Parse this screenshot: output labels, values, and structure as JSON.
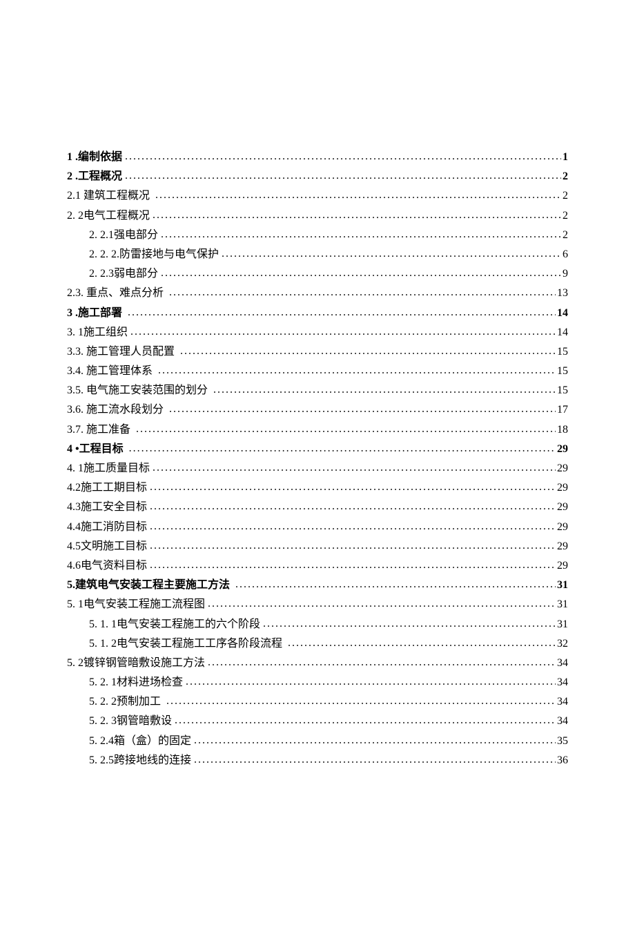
{
  "toc": [
    {
      "bold": true,
      "indent": 0,
      "num": "1",
      "sep": " .",
      "title": "编制依据",
      "page": "1"
    },
    {
      "bold": true,
      "indent": 0,
      "num": "2",
      "sep": " .",
      "title": "工程概况",
      "page": "2"
    },
    {
      "bold": false,
      "indent": 0,
      "num": "2.1",
      "sep": " ",
      "title": "建筑工程概况 ",
      "page": "2"
    },
    {
      "bold": false,
      "indent": 0,
      "num": "2. 2",
      "sep": "",
      "title": "电气工程概况",
      "page": "2"
    },
    {
      "bold": false,
      "indent": 1,
      "num": "2. 2.1",
      "sep": "",
      "title": "强电部分",
      "page": "2"
    },
    {
      "bold": false,
      "indent": 1,
      "num": "2. 2. 2.",
      "sep": "",
      "title": "防雷接地与电气保护",
      "page": "6"
    },
    {
      "bold": false,
      "indent": 1,
      "num": "2. 2.3",
      "sep": "",
      "title": "弱电部分",
      "page": "9"
    },
    {
      "bold": false,
      "indent": 0,
      "num": "2.3.",
      "sep": " ",
      "title": "重点、难点分析 ",
      "page": "13"
    },
    {
      "bold": true,
      "indent": 0,
      "num": "3",
      "sep": " .",
      "title": "施工部署 ",
      "page": "14"
    },
    {
      "bold": false,
      "indent": 0,
      "num": "3. 1",
      "sep": "",
      "title": "施工组织",
      "page": "14"
    },
    {
      "bold": false,
      "indent": 0,
      "num": "3.3.",
      "sep": " ",
      "title": "施工管理人员配置 ",
      "page": "15"
    },
    {
      "bold": false,
      "indent": 0,
      "num": "3.4.",
      "sep": " ",
      "title": "施工管理体系 ",
      "page": "15"
    },
    {
      "bold": false,
      "indent": 0,
      "num": "3.5.",
      "sep": " ",
      "title": "电气施工安装范围的划分 ",
      "page": "15"
    },
    {
      "bold": false,
      "indent": 0,
      "num": "3.6.",
      "sep": " ",
      "title": "施工流水段划分 ",
      "page": "17"
    },
    {
      "bold": false,
      "indent": 0,
      "num": "3.7.",
      "sep": " ",
      "title": "施工准备 ",
      "page": "18"
    },
    {
      "bold": true,
      "indent": 0,
      "num": "4",
      "sep": " •",
      "title": "工程目标 ",
      "page": "29"
    },
    {
      "bold": false,
      "indent": 0,
      "num": "4. 1",
      "sep": "",
      "title": "施工质量目标",
      "page": "29"
    },
    {
      "bold": false,
      "indent": 0,
      "num": "4.2",
      "sep": "",
      "title": "施工工期目标",
      "page": "29"
    },
    {
      "bold": false,
      "indent": 0,
      "num": "4.3",
      "sep": "",
      "title": "施工安全目标",
      "page": "29"
    },
    {
      "bold": false,
      "indent": 0,
      "num": "4.4",
      "sep": "",
      "title": "施工消防目标",
      "page": "29"
    },
    {
      "bold": false,
      "indent": 0,
      "num": "4.5",
      "sep": "",
      "title": "文明施工目标",
      "page": "29"
    },
    {
      "bold": false,
      "indent": 0,
      "num": "4.6",
      "sep": "",
      "title": "电气资料目标",
      "page": "29"
    },
    {
      "bold": true,
      "indent": 0,
      "num": "5.",
      "sep": "",
      "title": "建筑电气安装工程主要施工方法 ",
      "page": "31"
    },
    {
      "bold": false,
      "indent": 0,
      "num": "5. 1",
      "sep": "",
      "title": "电气安装工程施工流程图",
      "page": "31"
    },
    {
      "bold": false,
      "indent": 1,
      "num": "5. 1. 1",
      "sep": "",
      "title": "电气安装工程施工的六个阶段",
      "page": "31"
    },
    {
      "bold": false,
      "indent": 1,
      "num": "5. 1. 2",
      "sep": "",
      "title": "电气安装工程施工工序各阶段流程 ",
      "page": "32"
    },
    {
      "bold": false,
      "indent": 0,
      "num": "5. 2",
      "sep": "",
      "title": "镀锌钢管暗敷设施工方法",
      "page": "34"
    },
    {
      "bold": false,
      "indent": 1,
      "num": "5. 2. 1",
      "sep": "",
      "title": "材料进场检查",
      "page": "34"
    },
    {
      "bold": false,
      "indent": 1,
      "num": "5. 2. 2",
      "sep": "",
      "title": "预制加工 ",
      "page": "34"
    },
    {
      "bold": false,
      "indent": 1,
      "num": "5. 2. 3",
      "sep": "",
      "title": "钢管暗敷设",
      "page": "34"
    },
    {
      "bold": false,
      "indent": 1,
      "num": "5. 2.4",
      "sep": "",
      "title": "箱（盒）的固定",
      "page": "35"
    },
    {
      "bold": false,
      "indent": 1,
      "num": "5. 2.5",
      "sep": "",
      "title": "跨接地线的连接",
      "page": "36"
    }
  ]
}
